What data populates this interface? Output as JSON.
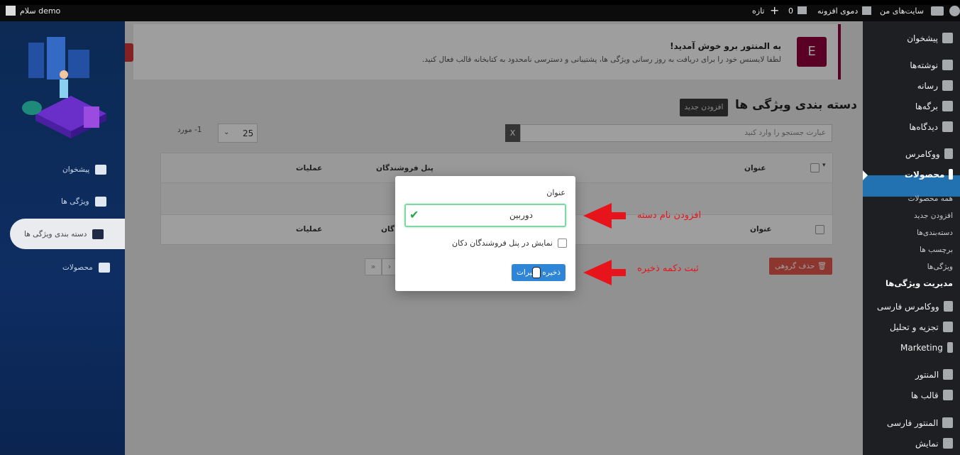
{
  "adminbar": {
    "user_greeting": "سلام demo",
    "my_sites": "سایت‌های من",
    "site_name": "دموی افزونه",
    "comments_count": "0",
    "new_label": "تازه"
  },
  "wp_menu": {
    "items": [
      {
        "label": "پیشخوان",
        "icon": "dashboard-icon"
      },
      {
        "label": "نوشته‌ها",
        "icon": "pin-icon"
      },
      {
        "label": "رسانه",
        "icon": "media-icon"
      },
      {
        "label": "برگه‌ها",
        "icon": "pages-icon"
      },
      {
        "label": "دیدگاه‌ها",
        "icon": "comments-icon"
      },
      {
        "label": "ووکامرس",
        "icon": "woo-icon"
      },
      {
        "label": "محصولات",
        "icon": "products-icon"
      }
    ],
    "sub_items": [
      "همه محصولات",
      "افزودن جدید",
      "دسته‌بندی‌ها",
      "برچسب ها",
      "ویژگی‌ها",
      "مدیریت ویژگی‌ها"
    ],
    "items_after": [
      {
        "label": "ووکامرس فارسی",
        "icon": "woo-persian-icon"
      },
      {
        "label": "تجزیه و تحلیل",
        "icon": "analytics-icon"
      },
      {
        "label": "Marketing",
        "icon": "megaphone-icon"
      },
      {
        "label": "المنتور",
        "icon": "elementor-icon"
      },
      {
        "label": "قالب ها",
        "icon": "templates-icon"
      },
      {
        "label": "المنتور فارسی",
        "icon": "elementor-persian-icon"
      },
      {
        "label": "نمایش",
        "icon": "brush-icon"
      }
    ]
  },
  "vendor_sidebar": {
    "items": [
      {
        "label": "پیشخوان",
        "icon": "home-icon"
      },
      {
        "label": "ویژگی ها",
        "icon": "list-icon"
      },
      {
        "label": "دسته بندی ویژگی ها",
        "icon": "grid-icon"
      },
      {
        "label": "محصولات",
        "icon": "cart-icon"
      }
    ]
  },
  "notice": {
    "title": "به المنتور برو خوش آمدید!",
    "body": "لطفا لایسنس خود را برای دریافت به روز رسانی ویژگی ها، پشتیبانی و دسترسی نامحدود به کتابخانه قالب فعال کنید."
  },
  "page": {
    "title": "دسته بندی ویژگی ها",
    "add_new_button": "افزودن جدید",
    "search_placeholder": "عبارت جستجو را وارد کنید",
    "search_clear": "X",
    "per_page": "25",
    "items_count": "1- مورد",
    "columns": {
      "title": "عنوان",
      "vendor_panel": "پنل فروشندگان",
      "actions": "عملیات"
    },
    "row": {
      "title": "عنوان",
      "vendor_panel": "گان",
      "actions": "عملیات"
    },
    "bulk_delete": "حذف گروهی",
    "pagination_next": "»",
    "pagination_next2": "›"
  },
  "modal": {
    "label": "عنوان",
    "input_value": "دوربین",
    "checkbox_label": "نمایش در پنل فروشندگان دکان",
    "save_button": "ذخیره تغییرات"
  },
  "annotations": {
    "name_hint": "افزودن نام دسته",
    "save_hint": "ثبت دکمه ذخیره"
  },
  "colors": {
    "accent": "#2271b1",
    "annotation": "#e8141b",
    "elementor": "#92003b",
    "success": "#28a745"
  }
}
